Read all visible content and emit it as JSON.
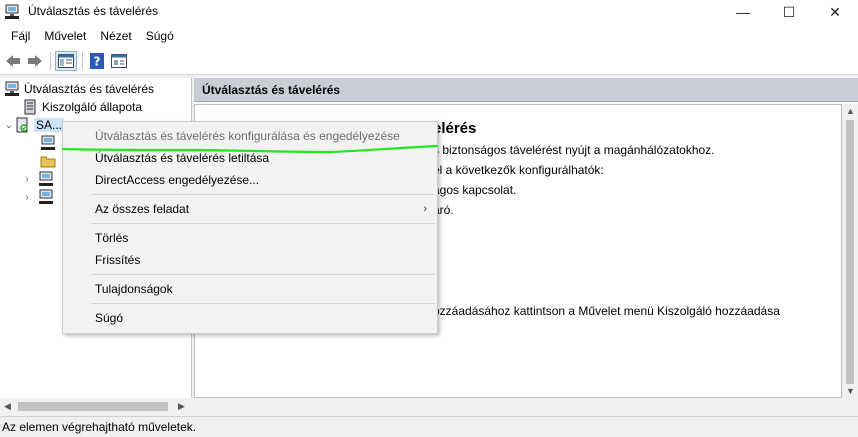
{
  "window": {
    "title": "Útválasztás és távelérés",
    "controls": {
      "minimize": "—",
      "maximize": "☐",
      "close": "✕"
    }
  },
  "menubar": {
    "items": [
      "Fájl",
      "Művelet",
      "Nézet",
      "Súgó"
    ]
  },
  "toolbar": {
    "buttons": [
      "back-icon",
      "forward-icon",
      "show-hide-tree-icon",
      "help-icon",
      "properties-icon"
    ]
  },
  "tree": {
    "root": "Útválasztás és távelérés",
    "status": "Kiszolgáló állapota",
    "server": "SA..."
  },
  "pane": {
    "header": "Útválasztás és távelérés",
    "content_lines": [
      "elérés",
      "s biztonságos távelérést nyújt a magánhálózatokhoz.",
      "el a következők konfigurálhatók:",
      "ágos kapcsolat.",
      "áró.",
      "ozzáadásához kattintson a Művelet menü Kiszolgáló hozzáadása"
    ]
  },
  "context_menu": {
    "items": [
      {
        "label": "Útválasztás és távelérés konfigurálása és engedélyezése",
        "disabled": true
      },
      {
        "label": "Útválasztás és távelérés letiltása"
      },
      {
        "label": "DirectAccess engedélyezése..."
      },
      {
        "label": "Az összes feladat",
        "submenu": true
      },
      {
        "label": "Törlés"
      },
      {
        "label": "Frissítés"
      },
      {
        "label": "Tulajdonságok"
      },
      {
        "label": "Súgó"
      }
    ]
  },
  "statusbar": {
    "text": "Az elemen végrehajtható műveletek."
  },
  "colors": {
    "pane_header": "#c9ced6",
    "annotation_stroke": "#22e81c"
  }
}
